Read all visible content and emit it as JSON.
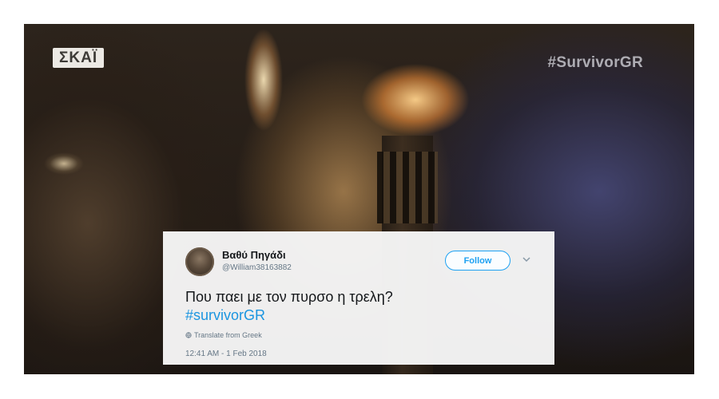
{
  "video": {
    "channel_logo": "ΣΚΑΪ",
    "hashtag_overlay": "#SurvivorGR"
  },
  "tweet": {
    "display_name": "Βαθύ Πηγάδι",
    "handle": "@William38163882",
    "follow_label": "Follow",
    "text": "Που παει με τον πυρσο η τρελη?",
    "hashtag": "#survivorGR",
    "translate_label": "Translate from Greek",
    "timestamp": "12:41 AM - 1 Feb 2018",
    "accent_color": "#1da1f2"
  },
  "icons": {
    "follow_menu": "chevron-down-icon",
    "translate": "globe-icon"
  }
}
